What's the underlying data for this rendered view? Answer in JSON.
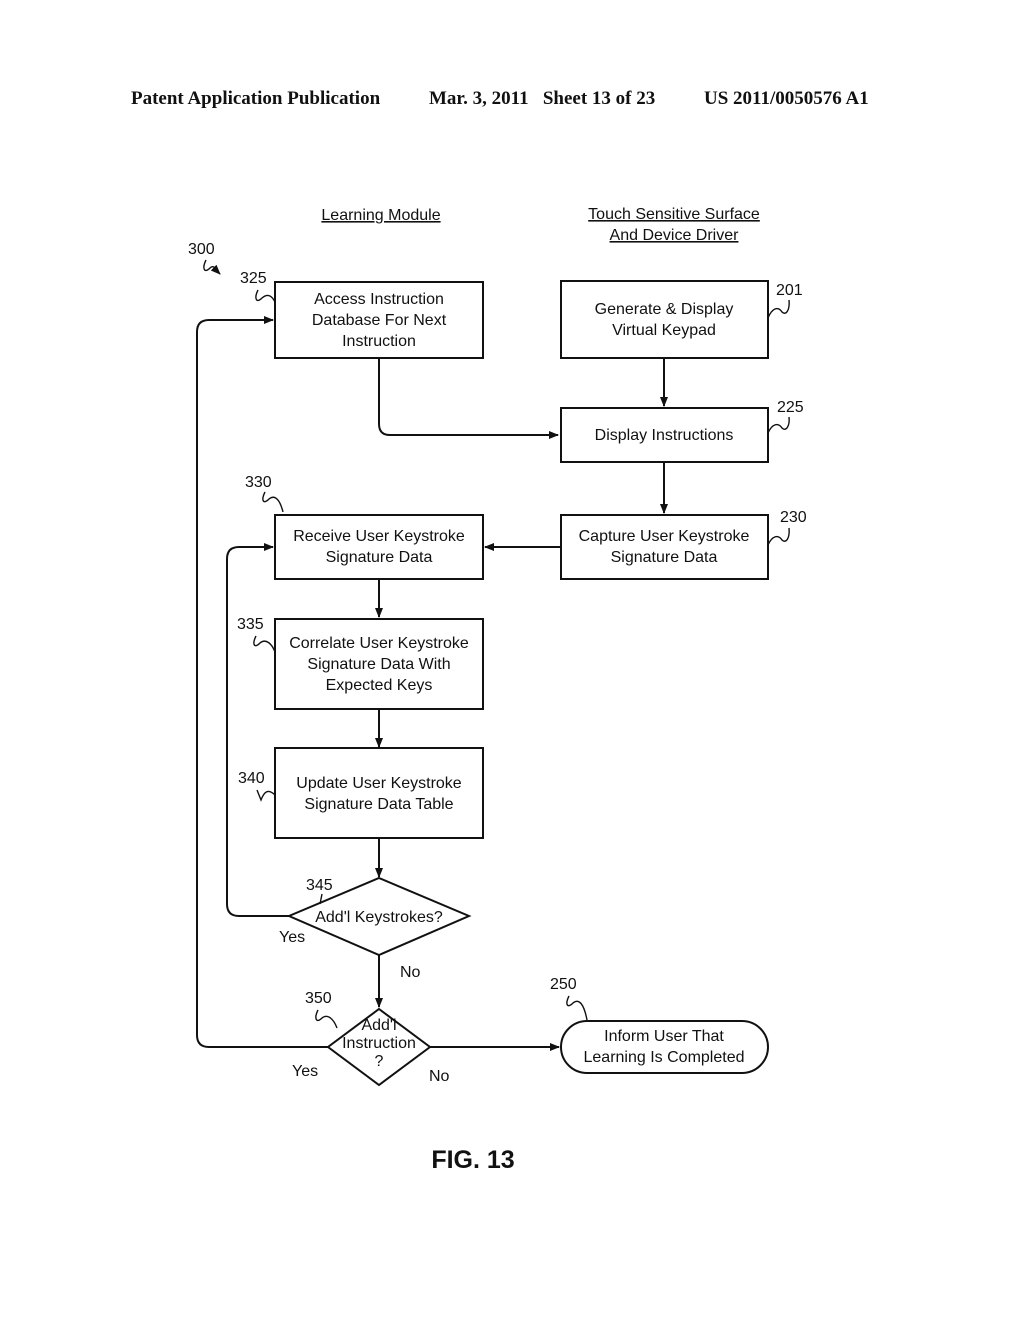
{
  "header": {
    "publication": "Patent Application Publication",
    "date_sheet": "Mar. 3, 2011   Sheet 13 of 23",
    "patent_number": "US 2011/0050576 A1"
  },
  "columns": {
    "learning_module": "Learning Module",
    "touch_surface_line1": "Touch Sensitive Surface",
    "touch_surface_line2": "And Device Driver"
  },
  "figure_ref": "300",
  "nodes": {
    "n325": {
      "ref": "325",
      "lines": [
        "Access Instruction",
        "Database For Next",
        "Instruction"
      ]
    },
    "n201": {
      "ref": "201",
      "lines": [
        "Generate & Display",
        "Virtual Keypad"
      ]
    },
    "n225": {
      "ref": "225",
      "lines": [
        "Display Instructions"
      ]
    },
    "n230": {
      "ref": "230",
      "lines": [
        "Capture User Keystroke",
        "Signature Data"
      ]
    },
    "n330": {
      "ref": "330",
      "lines": [
        "Receive User Keystroke",
        "Signature Data"
      ]
    },
    "n335": {
      "ref": "335",
      "lines": [
        "Correlate User Keystroke",
        "Signature Data With",
        "Expected Keys"
      ]
    },
    "n340": {
      "ref": "340",
      "lines": [
        "Update User Keystroke",
        "Signature Data Table"
      ]
    },
    "n345": {
      "ref": "345",
      "lines": [
        "Add'l Keystrokes?"
      ],
      "yes": "Yes",
      "no": "No"
    },
    "n350": {
      "ref": "350",
      "lines": [
        "Add'l",
        "Instruction",
        "?"
      ],
      "yes": "Yes",
      "no": "No"
    },
    "n250": {
      "ref": "250",
      "lines": [
        "Inform User That",
        "Learning Is Completed"
      ]
    }
  },
  "figure_label": "FIG. 13"
}
